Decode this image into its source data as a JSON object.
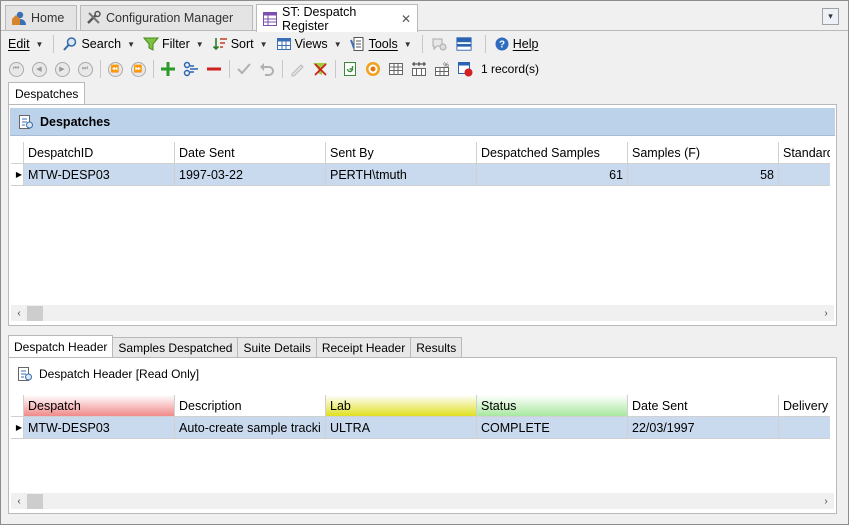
{
  "tabs": [
    {
      "label": "Home",
      "icon": "home-user-icon",
      "active": false
    },
    {
      "label": "Configuration Manager",
      "icon": "tools-icon",
      "active": false
    },
    {
      "label": "ST: Despatch Register",
      "icon": "register-icon",
      "active": true,
      "close": "✕"
    }
  ],
  "overflow_icon": "▾",
  "menu": {
    "edit": "Edit",
    "search": "Search",
    "filter": "Filter",
    "sort": "Sort",
    "views": "Views",
    "tools": "Tools",
    "help": "Help"
  },
  "toolbar": {
    "record_count": "1 record(s)"
  },
  "section_tab": "Despatches",
  "top_panel": {
    "title": "Despatches",
    "columns": [
      "DespatchID",
      "Date Sent",
      "Sent By",
      "Despatched Samples",
      "Samples (F)",
      "Standard"
    ],
    "rows": [
      {
        "despatch_id": "MTW-DESP03",
        "date_sent": "1997-03-22",
        "sent_by": "PERTH\\tmuth",
        "despatched_samples": "61",
        "samples_f": "58",
        "standard": ""
      }
    ]
  },
  "bottom_tabs": [
    "Despatch Header",
    "Samples Despatched",
    "Suite Details",
    "Receipt Header",
    "Results"
  ],
  "bottom_panel": {
    "title": "Despatch Header [Read Only]",
    "columns": [
      "Despatch",
      "Description",
      "Lab",
      "Status",
      "Date Sent",
      "Delivery"
    ],
    "column_colors": {
      "despatch": "#f08a8a",
      "lab": "#e0e020",
      "status": "#a8e8a0"
    },
    "rows": [
      {
        "despatch": "MTW-DESP03",
        "description": "Auto-create sample tracki",
        "lab": "ULTRA",
        "status": "COMPLETE",
        "date_sent": "22/03/1997",
        "delivery": ""
      }
    ]
  },
  "colors": {
    "panel_header": "#bcd2ea",
    "selected_row": "#c9d9ee"
  }
}
